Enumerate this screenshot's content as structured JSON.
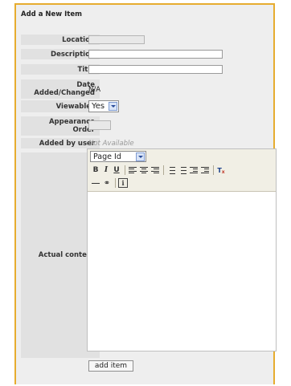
{
  "form": {
    "title": "Add a New Item",
    "labels": {
      "location": "Location",
      "description": "Description",
      "title": "Title",
      "date_line1": "Date",
      "date_line2": "Added/Changed",
      "viewable": "Viewable?",
      "order_line1": "Appearance",
      "order_line2": "Order",
      "added_by": "Added by user",
      "content": "Actual content"
    },
    "values": {
      "location": "",
      "description": "",
      "title": "",
      "date": "N/A",
      "viewable": "Yes",
      "order": "",
      "added_by": "Not Available"
    },
    "submit_label": "add item"
  },
  "editor": {
    "format_select": "Page Id",
    "tools": {
      "bold": "B",
      "italic": "I",
      "underline": "U",
      "info": "i"
    }
  },
  "colors": {
    "panel_border": "#e6ac2f",
    "panel_bg": "#eeeeee",
    "label_bg": "#e1e1e1"
  }
}
